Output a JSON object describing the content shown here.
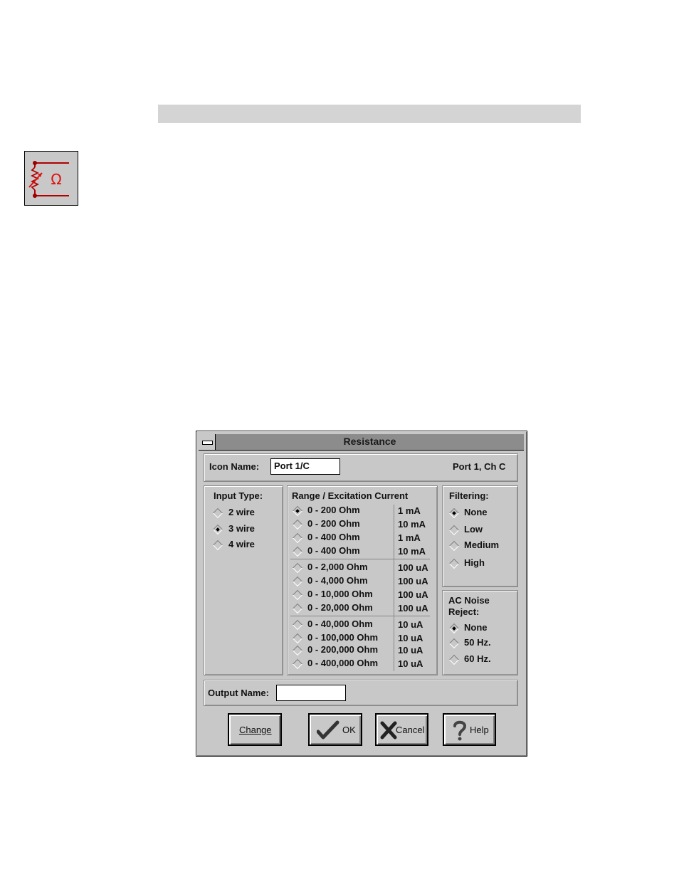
{
  "dialog": {
    "title": "Resistance",
    "icon_name_label": "Icon Name:",
    "icon_name_value": "Port 1/C",
    "port_info": "Port 1, Ch C",
    "output_name_label": "Output Name:",
    "output_name_value": ""
  },
  "input_type": {
    "label": "Input Type:",
    "options": [
      "2 wire",
      "3 wire",
      "4 wire"
    ],
    "selected": "3 wire"
  },
  "range": {
    "label": "Range / Excitation Current",
    "groups": [
      [
        {
          "range": "0 - 200 Ohm",
          "current": "1 mA"
        },
        {
          "range": "0 - 200 Ohm",
          "current": "10 mA"
        },
        {
          "range": "0 - 400 Ohm",
          "current": "1 mA"
        },
        {
          "range": "0 - 400 Ohm",
          "current": "10 mA"
        }
      ],
      [
        {
          "range": "0 - 2,000 Ohm",
          "current": "100 uA"
        },
        {
          "range": "0 - 4,000 Ohm",
          "current": "100 uA"
        },
        {
          "range": "0 - 10,000 Ohm",
          "current": "100 uA"
        },
        {
          "range": "0 - 20,000 Ohm",
          "current": "100 uA"
        }
      ],
      [
        {
          "range": "0 - 40,000 Ohm",
          "current": "10 uA"
        },
        {
          "range": "0 - 100,000 Ohm",
          "current": "10 uA"
        },
        {
          "range": "0 - 200,000 Ohm",
          "current": "10 uA"
        },
        {
          "range": "0 - 400,000 Ohm",
          "current": "10 uA"
        }
      ]
    ],
    "selected": "0 - 200 Ohm / 1 mA"
  },
  "filtering": {
    "label": "Filtering:",
    "options": [
      "None",
      "Low",
      "Medium",
      "High"
    ],
    "selected": "None"
  },
  "ac_noise": {
    "label_line1": "AC Noise",
    "label_line2": "Reject:",
    "options": [
      "None",
      "50 Hz.",
      "60 Hz."
    ],
    "selected": "None"
  },
  "buttons": {
    "change": "Change",
    "ok": "OK",
    "cancel": "Cancel",
    "help": "Help"
  },
  "icons": {
    "app_icon": "resistance-ohm-icon",
    "ok_icon": "checkmark-icon",
    "cancel_icon": "x-mark-icon",
    "help_icon": "question-mark-icon"
  },
  "colors": {
    "icon_red": "#e01010",
    "dialog_gray": "#c8c8c8",
    "title_gray": "#8c8c8c"
  }
}
